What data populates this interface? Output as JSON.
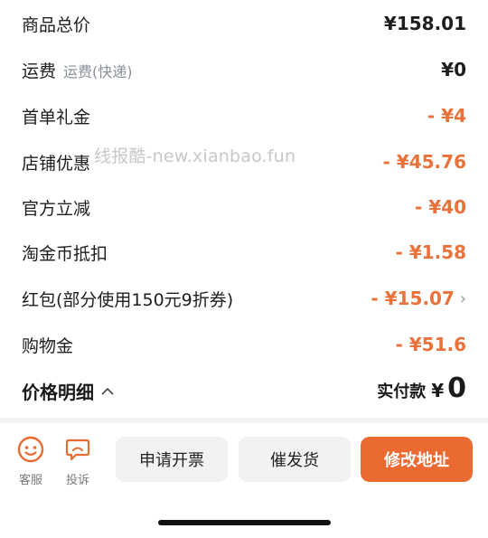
{
  "rows": [
    {
      "label": "商品总价",
      "sub": "",
      "amount": "¥158.01",
      "discount": false
    },
    {
      "label": "运费",
      "sub": "运费(快递)",
      "amount": "¥0",
      "discount": false
    },
    {
      "label": "首单礼金",
      "sub": "",
      "amount": "- ¥4",
      "discount": true
    },
    {
      "label": "店铺优惠",
      "sub": "",
      "amount": "- ¥45.76",
      "discount": true
    },
    {
      "label": "官方立减",
      "sub": "",
      "amount": "- ¥40",
      "discount": true
    },
    {
      "label": "淘金币抵扣",
      "sub": "",
      "amount": "- ¥1.58",
      "discount": true
    },
    {
      "label": "红包(部分使用150元9折券)",
      "sub": "",
      "amount": "- ¥15.07",
      "discount": true
    },
    {
      "label": "购物金",
      "sub": "",
      "amount": "- ¥51.6",
      "discount": true
    }
  ],
  "watermark": "线报酷-new.xianbao.fun",
  "summary": {
    "price_detail_label": "价格明细",
    "paid_label": "实付款",
    "paid_currency": "¥",
    "paid_value": "0"
  },
  "bottom_bar": {
    "service_label": "客服",
    "complaint_label": "投诉",
    "invoice_button": "申请开票",
    "urge_button": "催发货",
    "modify_address_button": "修改地址"
  },
  "colors": {
    "accent": "#ea6a31",
    "discount_text": "#e9723a"
  }
}
